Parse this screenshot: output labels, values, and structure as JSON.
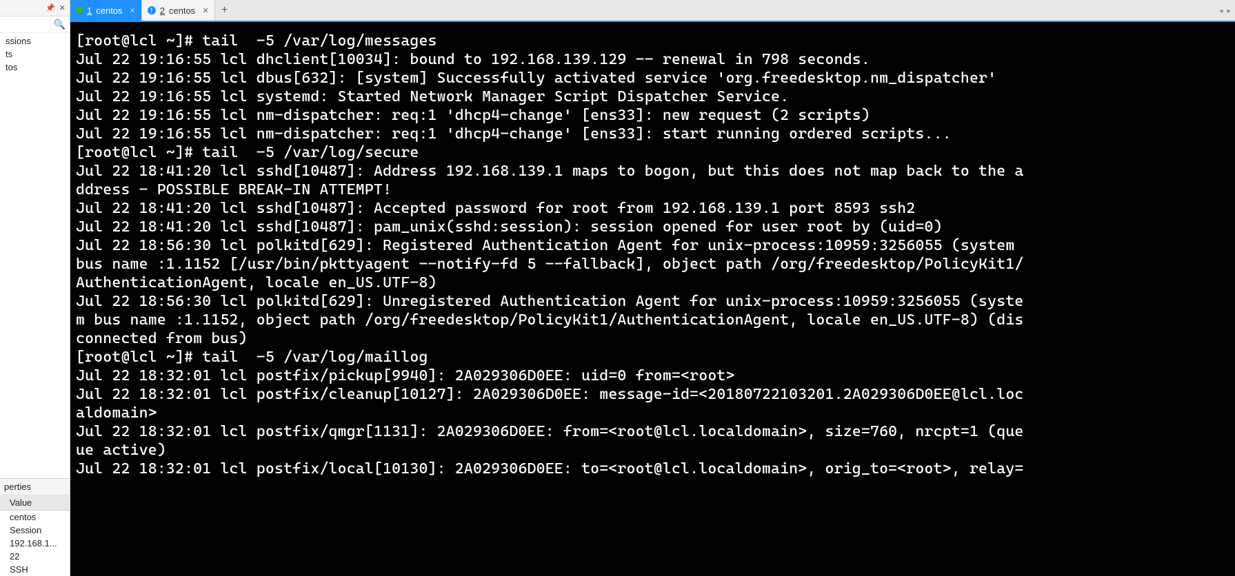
{
  "sidebar": {
    "tree": [
      "ssions",
      "ts",
      "tos"
    ],
    "props_header": "perties",
    "props_columns": [
      "Value"
    ],
    "props_rows": [
      "centos",
      "Session",
      "192.168.1...",
      "22",
      "SSH"
    ]
  },
  "tabs": [
    {
      "num": "1",
      "label": "centos",
      "active": true,
      "status": "green"
    },
    {
      "num": "2",
      "label": "centos",
      "active": false,
      "status": "info"
    }
  ],
  "newtab": "+",
  "tabbar_right": {
    "left": "◂",
    "right": "▸"
  },
  "terminal_lines": [
    "[root@lcl ~]# tail  -5 /var/log/messages",
    "Jul 22 19:16:55 lcl dhclient[10034]: bound to 192.168.139.129 -- renewal in 798 seconds.",
    "Jul 22 19:16:55 lcl dbus[632]: [system] Successfully activated service 'org.freedesktop.nm_dispatcher'",
    "Jul 22 19:16:55 lcl systemd: Started Network Manager Script Dispatcher Service.",
    "Jul 22 19:16:55 lcl nm-dispatcher: req:1 'dhcp4-change' [ens33]: new request (2 scripts)",
    "Jul 22 19:16:55 lcl nm-dispatcher: req:1 'dhcp4-change' [ens33]: start running ordered scripts...",
    "[root@lcl ~]# tail  -5 /var/log/secure",
    "Jul 22 18:41:20 lcl sshd[10487]: Address 192.168.139.1 maps to bogon, but this does not map back to the a",
    "ddress - POSSIBLE BREAK-IN ATTEMPT!",
    "Jul 22 18:41:20 lcl sshd[10487]: Accepted password for root from 192.168.139.1 port 8593 ssh2",
    "Jul 22 18:41:20 lcl sshd[10487]: pam_unix(sshd:session): session opened for user root by (uid=0)",
    "Jul 22 18:56:30 lcl polkitd[629]: Registered Authentication Agent for unix-process:10959:3256055 (system ",
    "bus name :1.1152 [/usr/bin/pkttyagent --notify-fd 5 --fallback], object path /org/freedesktop/PolicyKit1/",
    "AuthenticationAgent, locale en_US.UTF-8)",
    "Jul 22 18:56:30 lcl polkitd[629]: Unregistered Authentication Agent for unix-process:10959:3256055 (syste",
    "m bus name :1.1152, object path /org/freedesktop/PolicyKit1/AuthenticationAgent, locale en_US.UTF-8) (dis",
    "connected from bus)",
    "[root@lcl ~]# tail  -5 /var/log/maillog",
    "Jul 22 18:32:01 lcl postfix/pickup[9940]: 2A029306D0EE: uid=0 from=<root>",
    "Jul 22 18:32:01 lcl postfix/cleanup[10127]: 2A029306D0EE: message-id=<20180722103201.2A029306D0EE@lcl.loc",
    "aldomain>",
    "Jul 22 18:32:01 lcl postfix/qmgr[1131]: 2A029306D0EE: from=<root@lcl.localdomain>, size=760, nrcpt=1 (que",
    "ue active)",
    "Jul 22 18:32:01 lcl postfix/local[10130]: 2A029306D0EE: to=<root@lcl.localdomain>, orig_to=<root>, relay="
  ]
}
